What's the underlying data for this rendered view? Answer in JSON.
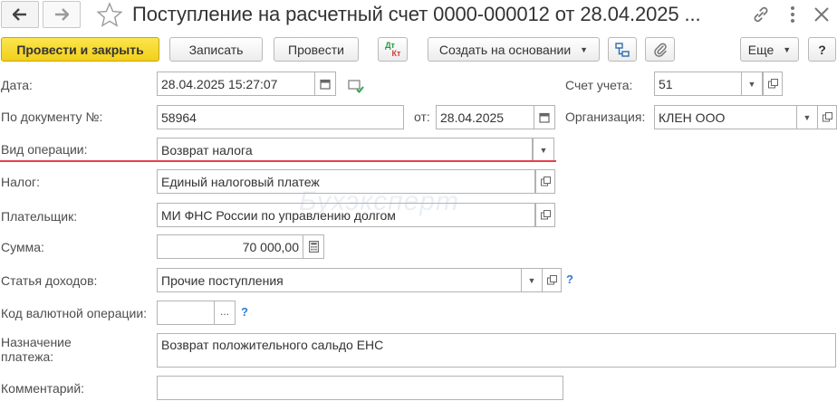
{
  "window": {
    "title": "Поступление на расчетный счет 0000-000012 от 28.04.2025 ..."
  },
  "toolbar": {
    "post_close_label": "Провести и закрыть",
    "save_label": "Записать",
    "post_label": "Провести",
    "dt_kt_label_top": "Дт",
    "dt_kt_label_bottom": "Кт",
    "create_based_label": "Создать на основании",
    "more_label": "Еще",
    "help_label": "?"
  },
  "form": {
    "date": {
      "label": "Дата:",
      "value": "28.04.2025 15:27:07"
    },
    "account": {
      "label": "Счет учета:",
      "value": "51"
    },
    "doc_number": {
      "label": "По документу №:",
      "value": "58964"
    },
    "doc_date": {
      "label": "от:",
      "value": "28.04.2025"
    },
    "organization": {
      "label": "Организация:",
      "value": "КЛЕН ООО"
    },
    "operation_type": {
      "label": "Вид операции:",
      "value": "Возврат налога"
    },
    "tax": {
      "label": "Налог:",
      "value": "Единый налоговый платеж"
    },
    "payer": {
      "label": "Плательщик:",
      "value": "МИ ФНС России по управлению долгом"
    },
    "amount": {
      "label": "Сумма:",
      "value": "70 000,00"
    },
    "income_item": {
      "label": "Статья доходов:",
      "value": "Прочие поступления"
    },
    "currency_op_code": {
      "label": "Код валютной операции:",
      "value": "",
      "select_label": "..."
    },
    "purpose": {
      "label_line1": "Назначение",
      "label_line2": "платежа:",
      "value": "Возврат положительного сальдо ЕНС"
    },
    "comment": {
      "label": "Комментарий:",
      "value": ""
    },
    "help_mark": "?"
  },
  "watermark": "Бухэксперт",
  "colors": {
    "primary_button": "#f2cf1c",
    "underline_accent": "#e8404b",
    "help_link": "#2e7bd6"
  }
}
